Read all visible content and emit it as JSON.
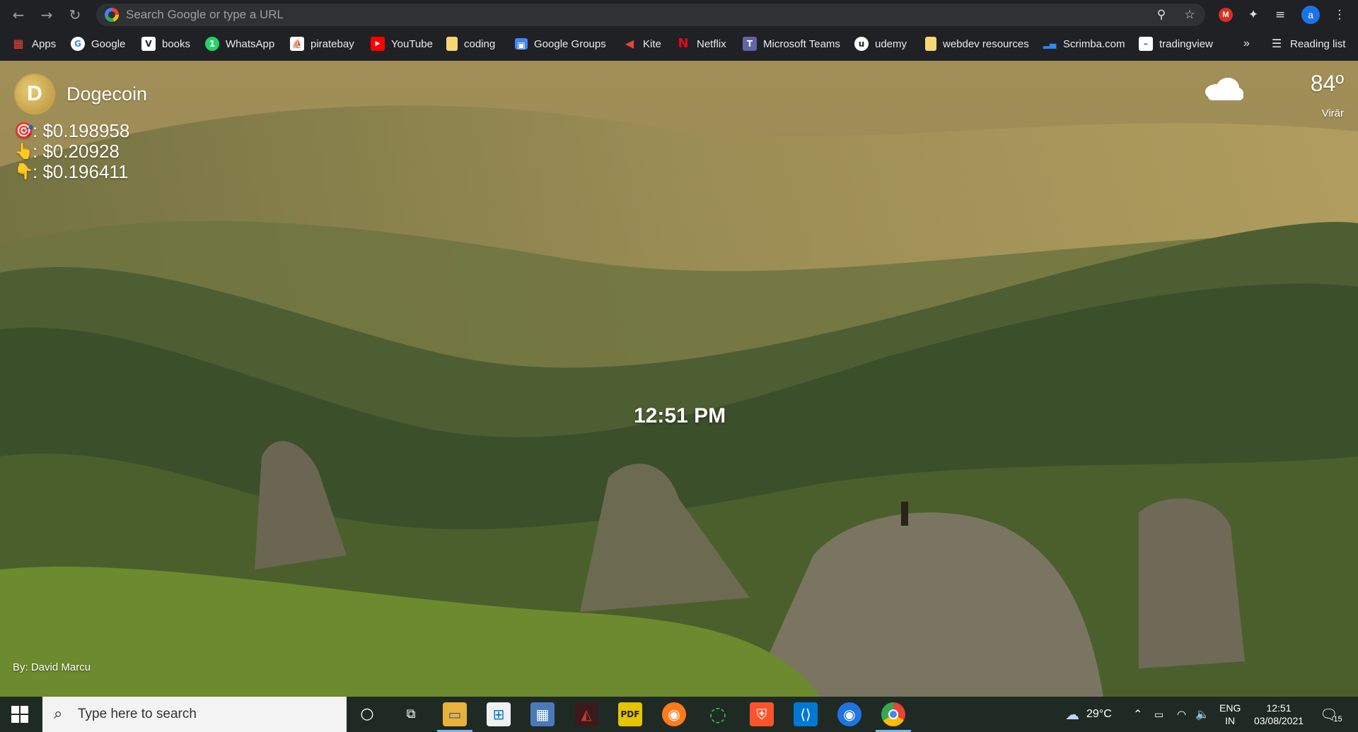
{
  "browser": {
    "omnibox_placeholder": "Search Google or type a URL",
    "profile_initial": "a",
    "ext_m_label": "M",
    "bookmarks": [
      {
        "label": "Apps",
        "icon": "apps-grid-icon",
        "color": "#4285f4"
      },
      {
        "label": "Google",
        "icon": "google-icon",
        "color": "#ffffff"
      },
      {
        "label": "books",
        "icon": "v-icon",
        "color": "#ffffff"
      },
      {
        "label": "WhatsApp",
        "icon": "whatsapp-icon",
        "color": "#25d366"
      },
      {
        "label": "piratebay",
        "icon": "ship-icon",
        "color": "#ffffff"
      },
      {
        "label": "YouTube",
        "icon": "youtube-icon",
        "color": "#ff0000"
      },
      {
        "label": "coding",
        "icon": "folder-icon",
        "color": "#f7d774"
      },
      {
        "label": "Google Groups",
        "icon": "groups-icon",
        "color": "#4285f4"
      },
      {
        "label": "Kite",
        "icon": "kite-icon",
        "color": "#ea4335"
      },
      {
        "label": "Netflix",
        "icon": "netflix-icon",
        "color": "#e50914"
      },
      {
        "label": "Microsoft Teams",
        "icon": "teams-icon",
        "color": "#6264a7"
      },
      {
        "label": "udemy",
        "icon": "udemy-icon",
        "color": "#ffffff"
      },
      {
        "label": "webdev resources",
        "icon": "folder-icon",
        "color": "#f7d774"
      },
      {
        "label": "Scrimba.com",
        "icon": "scrimba-icon",
        "color": "#2b89ff"
      },
      {
        "label": "tradingview",
        "icon": "tradingview-icon",
        "color": "#2962ff"
      }
    ],
    "overflow_label": "»",
    "reading_list_label": "Reading list"
  },
  "widget": {
    "coin_name": "Dogecoin",
    "coin_logo_letter": "D",
    "current_price": ": $0.198958",
    "high_price": ": $0.20928",
    "low_price": ": $0.196411"
  },
  "weather": {
    "temp": "84º",
    "location": "Virār"
  },
  "clock": "12:51 PM",
  "credit": "By: David Marcu",
  "taskbar": {
    "search_placeholder": "Type here to search",
    "weather_temp": "29°C",
    "lang_line1": "ENG",
    "lang_line2": "IN",
    "time": "12:51",
    "date": "03/08/2021",
    "notification_count": "15"
  }
}
